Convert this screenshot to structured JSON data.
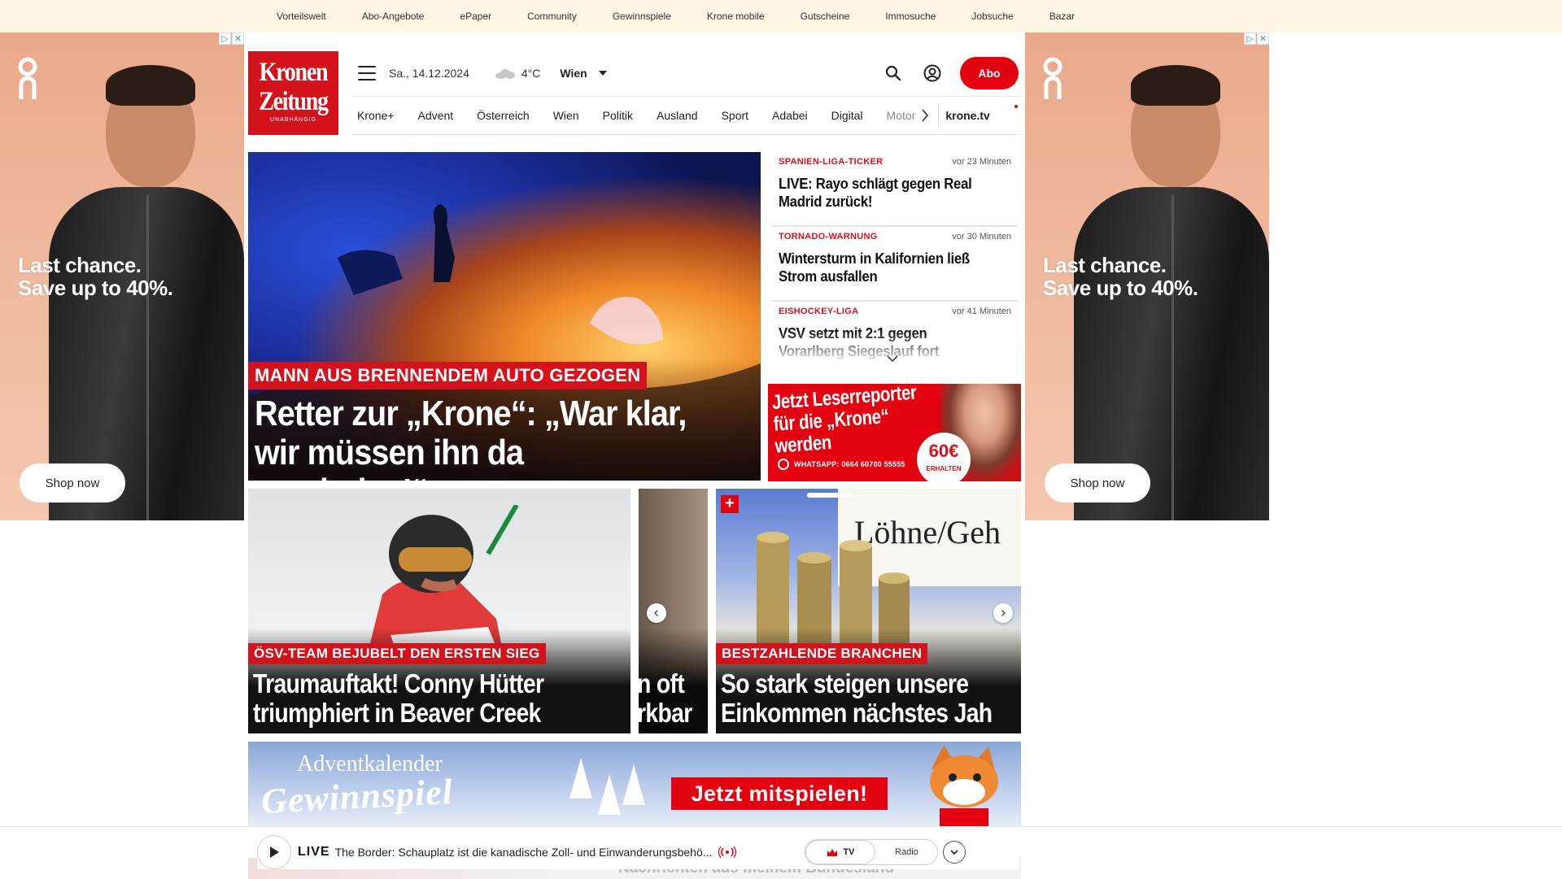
{
  "top_links": [
    "Vorteilswelt",
    "Abo-Angebote",
    "ePaper",
    "Community",
    "Gewinnspiele",
    "Krone mobile",
    "Gutscheine",
    "Immosuche",
    "Jobsuche",
    "Bazar"
  ],
  "side_ad": {
    "headline_line1": "Last chance.",
    "headline_line2": "Save up to 40%.",
    "button": "Shop now",
    "brand_icon": "on-logo-icon",
    "adchoices": "▷",
    "close": "✕"
  },
  "logo": {
    "line1": "Kronen",
    "line2": "Zeitung",
    "tagline": "UNABHÄNGIG"
  },
  "header": {
    "date": "Sa., 14.12.2024",
    "temperature": "4°C",
    "city": "Wien",
    "abo_button": "Abo",
    "weather_icon": "cloud-icon"
  },
  "nav": {
    "items": [
      "Krone+",
      "Advent",
      "Österreich",
      "Wien",
      "Politik",
      "Ausland",
      "Sport",
      "Adabei",
      "Digital"
    ],
    "faded_item": "Motor",
    "tv": "krone.tv"
  },
  "hero": {
    "kicker": "MANN AUS BRENNENDEM AUTO GEZOGEN",
    "title": "Retter zur „Krone“: „War klar, wir müssen ihn da rausholen!“"
  },
  "ticker": [
    {
      "category": "SPANIEN-LIGA-TICKER",
      "time": "vor 23 Minuten",
      "headline": "LIVE: Rayo schlägt gegen Real Madrid zurück!"
    },
    {
      "category": "TORNADO-WARNUNG",
      "time": "vor 30 Minuten",
      "headline": "Wintersturm in Kalifornien ließ Strom ausfallen"
    },
    {
      "category": "EISHOCKEY-LIGA",
      "time": "vor 41 Minuten",
      "headline": "VSV setzt mit 2:1 gegen Vorarlberg Siegeslauf fort"
    }
  ],
  "reporter_ad": {
    "line1": "Jetzt Leserreporter",
    "line2": "für die „Krone“ werden",
    "whatsapp": "WHATSAPP: 0664 60700 55555",
    "amount": "60€",
    "amount_label": "ERHALTEN"
  },
  "carousel": [
    {
      "kicker": "ÖSV-TEAM BEJUBELT DEN ERSTEN SIEG",
      "title_line1": "Traumauftakt! Conny Hütter",
      "title_line2": "triumphiert in Beaver Creek"
    },
    {
      "title_line1": "n oft",
      "title_line2": "rkbar"
    },
    {
      "kicker": "BESTZAHLENDE BRANCHEN",
      "title_line1": "So stark steigen unsere",
      "title_line2": "Einkommen nächstes Jah",
      "image_text": "Löhne/Geh",
      "plus": "+"
    }
  ],
  "advent": {
    "line1": "Adventkalender",
    "line2": "Gewinnspiel",
    "cta": "Jetzt mitspielen!"
  },
  "player": {
    "live_label": "LIVE",
    "text": "The Border: Schauplatz ist die kanadische Zoll- und Einwanderungsbehö...",
    "tv_label": "TV",
    "radio_label": "Radio",
    "underlying_text": "Nachrichten aus meinem Bundesland"
  },
  "colors": {
    "brand_red": "#e3000f",
    "kicker_red": "#d4121c",
    "topbar_bg": "#fdf6e4"
  }
}
